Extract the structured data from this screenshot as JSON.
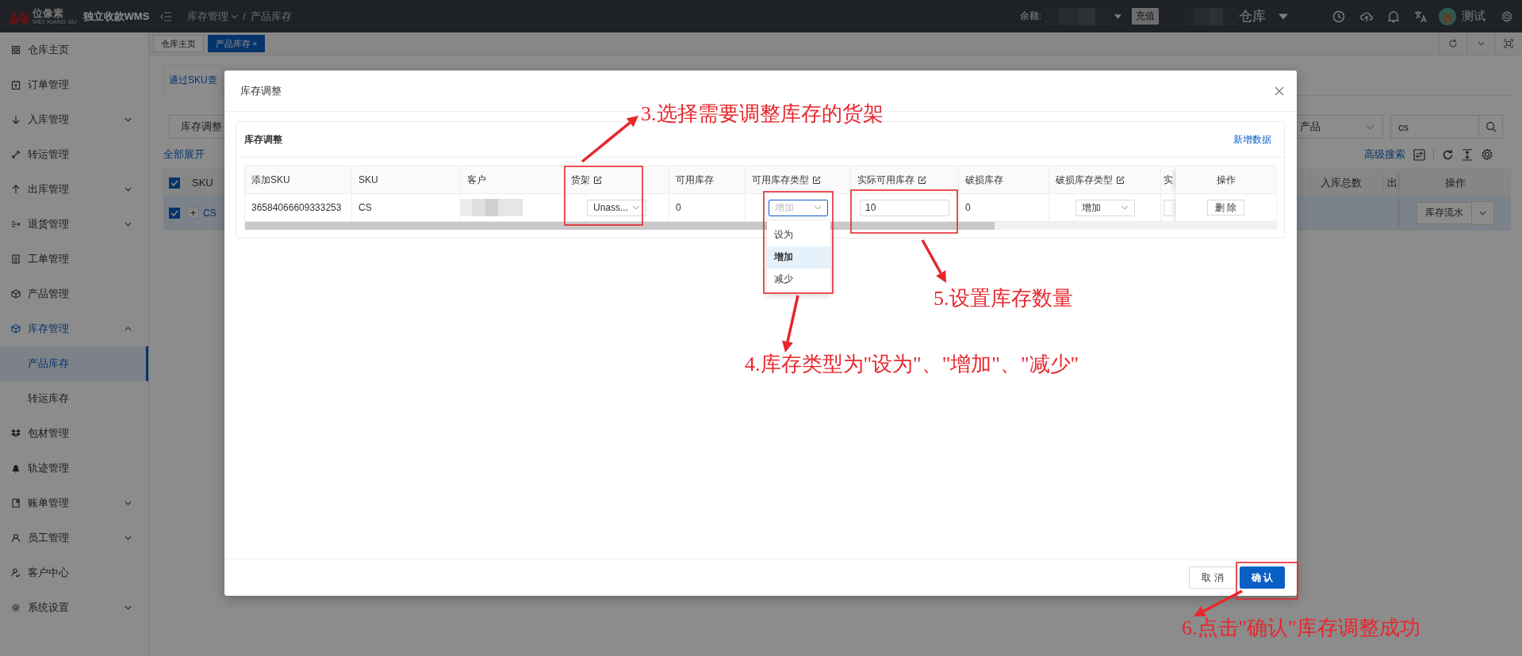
{
  "topbar": {
    "logo": "位像素",
    "logo_subtitle": "WEI XIANG SU",
    "app_name": "独立收款WMS",
    "breadcrumb": [
      "库存管理",
      "产品库存"
    ],
    "breadcrumb_separator": "/",
    "balance_label": "余额:",
    "recharge_button": "充值",
    "warehouse": "仓库",
    "user": "测试"
  },
  "sidebar": {
    "items": [
      {
        "label": "仓库主页",
        "kind": "link",
        "selected": false
      },
      {
        "label": "订单管理",
        "kind": "link",
        "selected": false
      },
      {
        "label": "入库管理",
        "kind": "group",
        "expanded": false,
        "selected": false
      },
      {
        "label": "转运管理",
        "kind": "link",
        "selected": false
      },
      {
        "label": "出库管理",
        "kind": "group",
        "expanded": false,
        "selected": false
      },
      {
        "label": "退货管理",
        "kind": "group",
        "expanded": false,
        "selected": false
      },
      {
        "label": "工单管理",
        "kind": "link",
        "selected": false
      },
      {
        "label": "产品管理",
        "kind": "link",
        "selected": false
      },
      {
        "label": "库存管理",
        "kind": "group",
        "expanded": true,
        "selected": true,
        "children": [
          {
            "label": "产品库存",
            "selected": true
          },
          {
            "label": "转运库存",
            "selected": false
          }
        ]
      },
      {
        "label": "包材管理",
        "kind": "link",
        "selected": false
      },
      {
        "label": "轨迹管理",
        "kind": "link",
        "selected": false
      },
      {
        "label": "账单管理",
        "kind": "group",
        "expanded": false,
        "selected": false
      },
      {
        "label": "员工管理",
        "kind": "group",
        "expanded": false,
        "selected": false
      },
      {
        "label": "客户中心",
        "kind": "link",
        "selected": false
      },
      {
        "label": "系统设置",
        "kind": "group",
        "expanded": false,
        "selected": false
      }
    ]
  },
  "tabs": [
    {
      "label": "仓库主页",
      "selected": false
    },
    {
      "label": "产品库存",
      "selected": true,
      "close": "×"
    }
  ],
  "page": {
    "view_tab": "通过SKU查",
    "adjust_button": "库存调整",
    "expand_all": "全部展开",
    "filter_select": "产品",
    "search_value": "cs",
    "advanced_search": "高级搜索",
    "list": {
      "header_checked": true,
      "columns": [
        "SKU",
        "入库总数",
        "出",
        "操作"
      ],
      "rows": [
        {
          "checked": true,
          "expand": "+",
          "sku": "CS",
          "actions": [
            "库存流水"
          ]
        }
      ]
    }
  },
  "modal": {
    "title": "库存调整",
    "card_title": "库存调整",
    "add_link": "新增数据",
    "columns": [
      {
        "label": "添加SKU",
        "editable": false
      },
      {
        "label": "SKU",
        "editable": false
      },
      {
        "label": "客户",
        "editable": false
      },
      {
        "label": "货架",
        "editable": true
      },
      {
        "label": "可用库存",
        "editable": false
      },
      {
        "label": "可用库存类型",
        "editable": true
      },
      {
        "label": "实际可用库存",
        "editable": true
      },
      {
        "label": "破损库存",
        "editable": false
      },
      {
        "label": "破损库存类型",
        "editable": true
      },
      {
        "label": "实",
        "editable": false
      },
      {
        "label": "操作",
        "editable": false
      }
    ],
    "row": [
      {
        "kind": "text",
        "text": "36584066609333253"
      },
      {
        "kind": "text",
        "text": "CS"
      },
      {
        "kind": "redacted"
      },
      {
        "kind": "select",
        "value": "Unass...",
        "open": false
      },
      {
        "kind": "text",
        "text": "0"
      },
      {
        "kind": "select",
        "value": "增加",
        "open": true,
        "options": [
          {
            "label": "设为",
            "selected": false
          },
          {
            "label": "增加",
            "selected": true
          },
          {
            "label": "减少",
            "selected": false
          }
        ]
      },
      {
        "kind": "input",
        "value": "10"
      },
      {
        "kind": "text",
        "text": "0"
      },
      {
        "kind": "select",
        "value": "增加",
        "open": false
      },
      {
        "kind": "input"
      },
      {
        "kind": "button",
        "text": "删 除"
      }
    ],
    "footer_buttons": [
      {
        "label": "取 消",
        "kind": "default"
      },
      {
        "label": "确 认",
        "kind": "primary"
      }
    ]
  },
  "annotations": [
    {
      "text": "3.选择需要调整库存的货架"
    },
    {
      "text": "5.设置库存数量"
    },
    {
      "text": "4.库存类型为\"设为\"、\"增加\"、\"减少\""
    },
    {
      "text": "6.点击\"确认\"库存调整成功"
    }
  ]
}
